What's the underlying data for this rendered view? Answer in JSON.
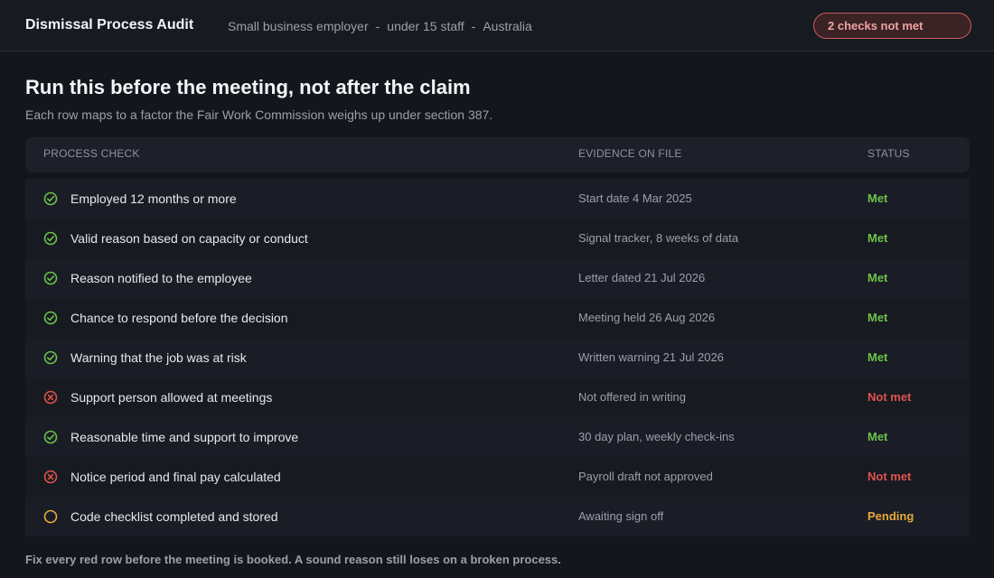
{
  "header": {
    "title": "Dismissal Process Audit",
    "meta": [
      "Small business employer",
      "under 15 staff",
      "Australia"
    ],
    "meta_separator": "-",
    "alert_badge": "2 checks not met"
  },
  "main": {
    "heading": "Run this before the meeting, not after the claim",
    "subheading": "Each row maps to a factor the Fair Work Commission weighs up under section 387.",
    "columns": [
      "PROCESS CHECK",
      "EVIDENCE ON FILE",
      "STATUS"
    ],
    "rows": [
      {
        "check": "Employed 12 months or more",
        "evidence": "Start date 4 Mar 2025",
        "status": "Met",
        "state": "met"
      },
      {
        "check": "Valid reason based on capacity or conduct",
        "evidence": "Signal tracker, 8 weeks of data",
        "status": "Met",
        "state": "met"
      },
      {
        "check": "Reason notified to the employee",
        "evidence": "Letter dated 21 Jul 2026",
        "status": "Met",
        "state": "met"
      },
      {
        "check": "Chance to respond before the decision",
        "evidence": "Meeting held 26 Aug 2026",
        "status": "Met",
        "state": "met"
      },
      {
        "check": "Warning that the job was at risk",
        "evidence": "Written warning 21 Jul 2026",
        "status": "Met",
        "state": "met"
      },
      {
        "check": "Support person allowed at meetings",
        "evidence": "Not offered in writing",
        "status": "Not met",
        "state": "not_met"
      },
      {
        "check": "Reasonable time and support to improve",
        "evidence": "30 day plan, weekly check-ins",
        "status": "Met",
        "state": "met"
      },
      {
        "check": "Notice period and final pay calculated",
        "evidence": "Payroll draft not approved",
        "status": "Not met",
        "state": "not_met"
      },
      {
        "check": "Code checklist completed and stored",
        "evidence": "Awaiting sign off",
        "status": "Pending",
        "state": "pending"
      }
    ],
    "footer_note": "Fix every red row before the meeting is booked. A sound reason still loses on a broken process."
  },
  "colors": {
    "met": "#6cc24a",
    "not_met": "#e0524d",
    "pending": "#e8a93a",
    "alert_border": "#c65b5b"
  },
  "icons": {
    "met": "check-circle-icon",
    "not_met": "x-circle-icon",
    "pending": "pending-circle-icon"
  }
}
